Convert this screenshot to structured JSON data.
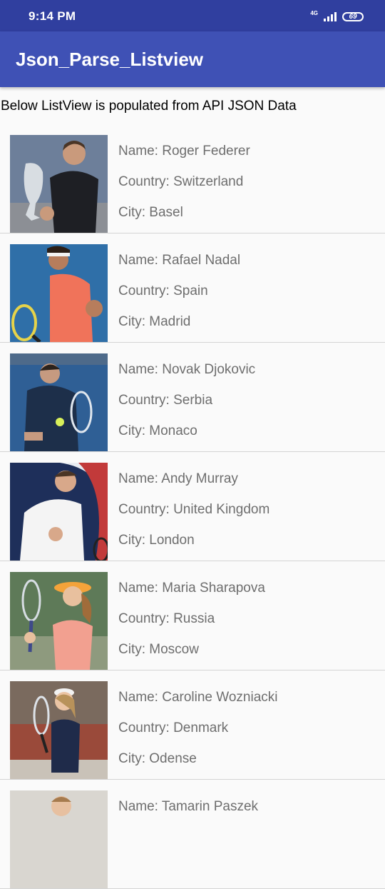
{
  "status_bar": {
    "time": "9:14 PM",
    "network": "4G",
    "battery": "69"
  },
  "app_bar": {
    "title": "Json_Parse_Listview"
  },
  "intro_text": "Below ListView is populated from API JSON Data",
  "players": [
    {
      "name": "Name: Roger Federer",
      "country": "Country: Switzerland",
      "city": "City: Basel"
    },
    {
      "name": "Name: Rafael Nadal",
      "country": "Country: Spain",
      "city": "City: Madrid"
    },
    {
      "name": "Name: Novak Djokovic",
      "country": "Country: Serbia",
      "city": "City: Monaco"
    },
    {
      "name": "Name: Andy Murray",
      "country": "Country: United Kingdom",
      "city": "City: London"
    },
    {
      "name": "Name: Maria Sharapova",
      "country": "Country: Russia",
      "city": "City: Moscow"
    },
    {
      "name": "Name: Caroline Wozniacki",
      "country": "Country: Denmark",
      "city": "City: Odense"
    },
    {
      "name": "Name: Tamarin Paszek",
      "country": "",
      "city": ""
    }
  ]
}
